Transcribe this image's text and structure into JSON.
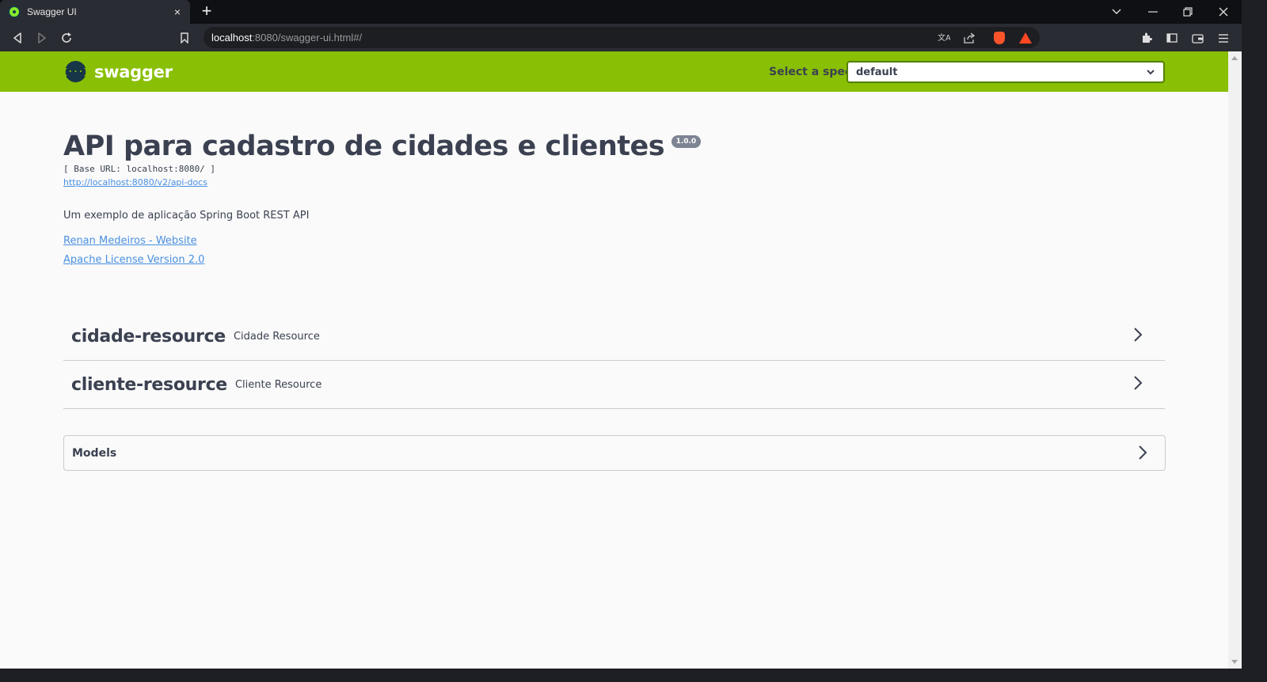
{
  "browser": {
    "tab_title": "Swagger UI",
    "tab_close": "×",
    "new_tab": "+",
    "url_host": "localhost",
    "url_rest": ":8080/swagger-ui.html#/"
  },
  "swagger": {
    "logo_text": "swagger",
    "logo_mark": "{···}",
    "spec_label": "Select a spec",
    "spec_value": "default"
  },
  "info": {
    "title": "API para cadastro de cidades e clientes",
    "version": "1.0.0",
    "base_url": "[ Base URL: localhost:8080/ ]",
    "spec_link": "http://localhost:8080/v2/api-docs",
    "description": "Um exemplo de aplicação Spring Boot REST API",
    "contact_link": "Renan Medeiros - Website",
    "license_link": "Apache License Version 2.0"
  },
  "tags": [
    {
      "name": "cidade-resource",
      "description": "Cidade Resource"
    },
    {
      "name": "cliente-resource",
      "description": "Cliente Resource"
    }
  ],
  "models": {
    "title": "Models"
  },
  "colors": {
    "swagger_green": "#89bf04",
    "text_dark": "#3b4151",
    "link_blue": "#4990e2",
    "brave_orange": "#fb542b"
  }
}
